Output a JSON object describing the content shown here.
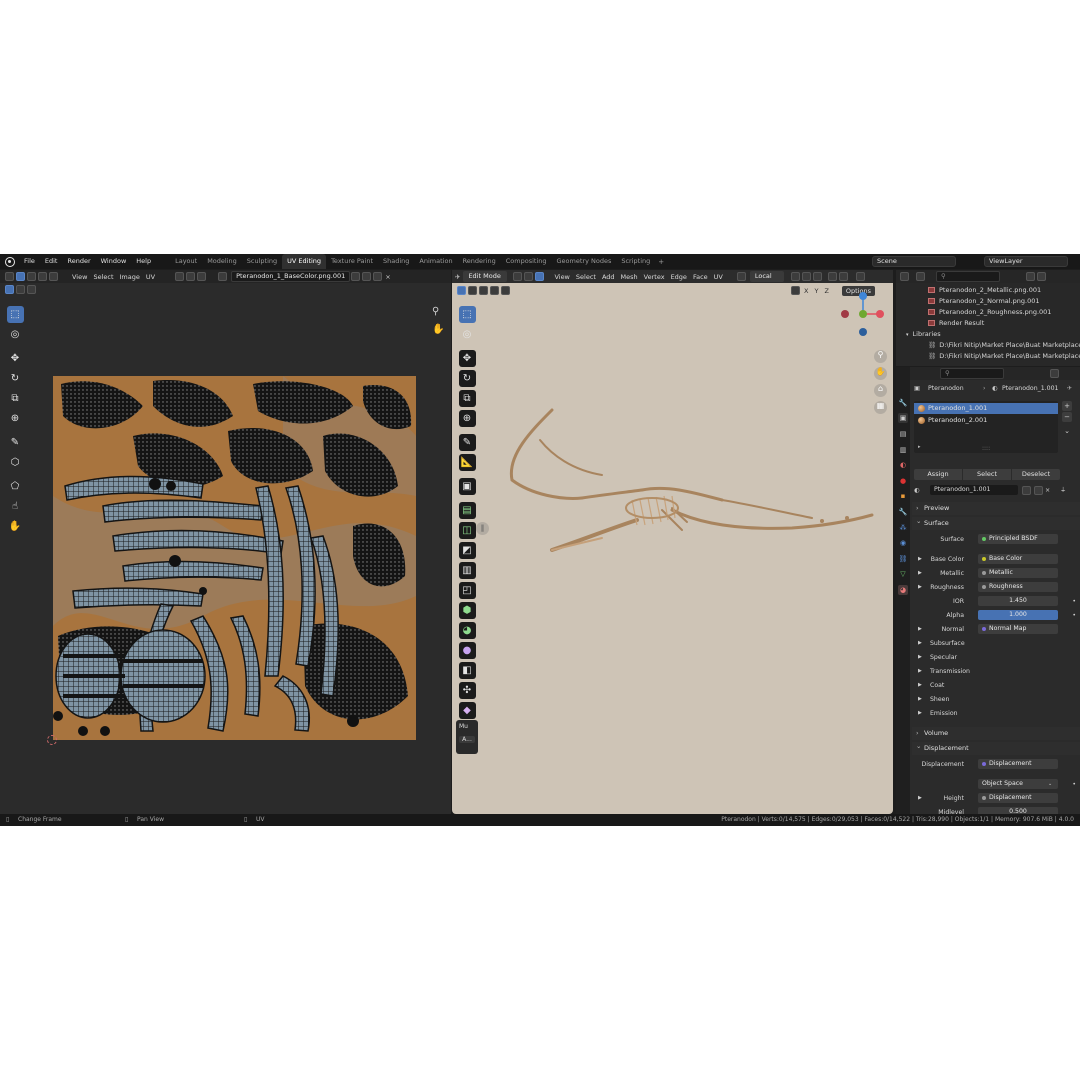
{
  "topbar": {
    "menus": [
      "File",
      "Edit",
      "Render",
      "Window",
      "Help"
    ],
    "workspaces": [
      "Layout",
      "Modeling",
      "Sculpting",
      "UV Editing",
      "Texture Paint",
      "Shading",
      "Animation",
      "Rendering",
      "Compositing",
      "Geometry Nodes",
      "Scripting"
    ],
    "active_workspace": "UV Editing",
    "add_workspace": "+",
    "scene": "Scene",
    "view_layer": "ViewLayer"
  },
  "uv_editor": {
    "header_menus": [
      "View",
      "Select",
      "Image",
      "UV"
    ],
    "image_name": "Pteranodon_1_BaseColor.png.001",
    "texture_colors": {
      "base": "#a8743e",
      "dark": "#141414",
      "mesh": "#7f94a4"
    }
  },
  "viewport": {
    "mode": "Edit Mode",
    "header_menus": [
      "View",
      "Select",
      "Add",
      "Mesh",
      "Vertex",
      "Edge",
      "Face",
      "UV"
    ],
    "transform_orientation": "Local",
    "axes": [
      "X",
      "Y",
      "Z"
    ],
    "options_label": "Options",
    "gizmo_colors": {
      "x": "#e0505e",
      "y": "#6fa832",
      "z": "#3f86d8"
    },
    "panel_labels": [
      "Mu",
      "A..."
    ],
    "background": "#cec4b6"
  },
  "outliner": {
    "items": [
      "Pteranodon_2_Metallic.png.001",
      "Pteranodon_2_Normal.png.001",
      "Pteranodon_2_Roughness.png.001",
      "Render Result"
    ],
    "libraries_label": "Libraries",
    "library_paths": [
      "D:\\Fikri Nitip\\Market Place\\Buat Marketplace Gl",
      "D:\\Fikri Nitip\\Market Place\\Buat Marketplace Gl"
    ]
  },
  "properties": {
    "breadcrumb": {
      "object": "Pteranodon",
      "material": "Pteranodon_1.001"
    },
    "materials": [
      "Pteranodon_1.001",
      "Pteranodon_2.001"
    ],
    "buttons": {
      "assign": "Assign",
      "select": "Select",
      "deselect": "Deselect"
    },
    "material_field": "Pteranodon_1.001",
    "sections": {
      "preview": "Preview",
      "surface": "Surface",
      "volume": "Volume",
      "displacement": "Displacement"
    },
    "surface": {
      "surface_label": "Surface",
      "surface_value": "Principled BSDF",
      "base_color_label": "Base Color",
      "base_color_value": "Base Color",
      "metallic_label": "Metallic",
      "metallic_value": "Metallic",
      "roughness_label": "Roughness",
      "roughness_value": "Roughness",
      "ior_label": "IOR",
      "ior_value": "1.450",
      "alpha_label": "Alpha",
      "alpha_value": "1.000",
      "normal_label": "Normal",
      "normal_value": "Normal Map"
    },
    "subpanels": [
      "Subsurface",
      "Specular",
      "Transmission",
      "Coat",
      "Sheen",
      "Emission"
    ],
    "displacement": {
      "disp_label": "Displacement",
      "disp_value": "Displacement",
      "space_value": "Object Space",
      "height_label": "Height",
      "height_value": "Displacement",
      "midlevel_label": "Midlevel",
      "midlevel_value": "0.500"
    }
  },
  "statusbar": {
    "left_action": "Change Frame",
    "mid_action": "Pan View",
    "right_action": "UV",
    "stats": "Pteranodon | Verts:0/14,575 | Edges:0/29,053 | Faces:0/14,522 | Tris:28,990 | Objects:1/1 | Memory: 907.6 MiB | 4.0.0"
  }
}
